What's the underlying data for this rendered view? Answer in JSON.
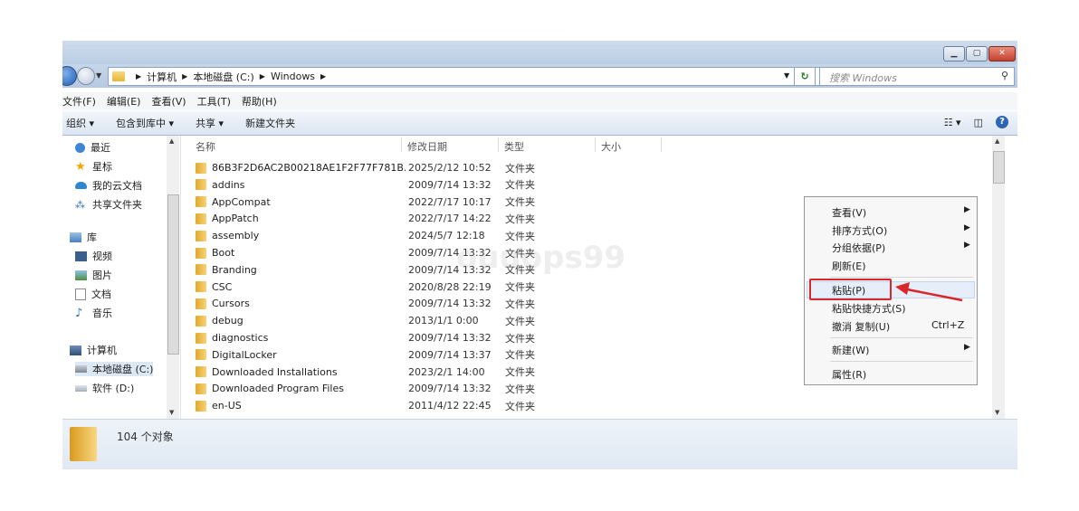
{
  "address": {
    "crumbs": [
      "计算机",
      "本地磁盘 (C:)",
      "Windows"
    ],
    "search_placeholder": "搜索 Windows"
  },
  "menubar": [
    "文件(F)",
    "编辑(E)",
    "查看(V)",
    "工具(T)",
    "帮助(H)"
  ],
  "toolbar": {
    "organize": "组织 ▾",
    "include": "包含到库中 ▾",
    "share": "共享 ▾",
    "newfolder": "新建文件夹"
  },
  "nav": {
    "recent": "最近",
    "starred": "星标",
    "cloud": "我的云文档",
    "shared": "共享文件夹",
    "library": "库",
    "video": "视频",
    "pictures": "图片",
    "docs": "文档",
    "music": "音乐",
    "computer": "计算机",
    "local_c": "本地磁盘 (C:)",
    "soft_d": "软件 (D:)"
  },
  "columns": {
    "name": "名称",
    "date": "修改日期",
    "type": "类型",
    "size": "大小"
  },
  "files": [
    {
      "name": "86B3F2D6AC2B00218AE1F2F77F781B...",
      "date": "2025/2/12 10:52",
      "type": "文件夹"
    },
    {
      "name": "addins",
      "date": "2009/7/14 13:32",
      "type": "文件夹"
    },
    {
      "name": "AppCompat",
      "date": "2022/7/17 10:17",
      "type": "文件夹"
    },
    {
      "name": "AppPatch",
      "date": "2022/7/17 14:22",
      "type": "文件夹"
    },
    {
      "name": "assembly",
      "date": "2024/5/7 12:18",
      "type": "文件夹"
    },
    {
      "name": "Boot",
      "date": "2009/7/14 13:32",
      "type": "文件夹"
    },
    {
      "name": "Branding",
      "date": "2009/7/14 13:32",
      "type": "文件夹"
    },
    {
      "name": "CSC",
      "date": "2020/8/28 22:19",
      "type": "文件夹"
    },
    {
      "name": "Cursors",
      "date": "2009/7/14 13:32",
      "type": "文件夹"
    },
    {
      "name": "debug",
      "date": "2013/1/1 0:00",
      "type": "文件夹"
    },
    {
      "name": "diagnostics",
      "date": "2009/7/14 13:32",
      "type": "文件夹"
    },
    {
      "name": "DigitalLocker",
      "date": "2009/7/14 13:37",
      "type": "文件夹"
    },
    {
      "name": "Downloaded Installations",
      "date": "2023/2/1 14:00",
      "type": "文件夹"
    },
    {
      "name": "Downloaded Program Files",
      "date": "2009/7/14 13:32",
      "type": "文件夹"
    },
    {
      "name": "en-US",
      "date": "2011/4/12 22:45",
      "type": "文件夹"
    }
  ],
  "status": {
    "count": "104 个对象"
  },
  "context_menu": {
    "view": "查看(V)",
    "sort": "排序方式(O)",
    "group": "分组依据(P)",
    "refresh": "刷新(E)",
    "paste": "粘贴(P)",
    "paste_shortcut": "粘贴快捷方式(S)",
    "undo": "撤消 复制(U)",
    "undo_shortcut": "Ctrl+Z",
    "new": "新建(W)",
    "properties": "属性(R)"
  },
  "watermark": "ouuops99"
}
